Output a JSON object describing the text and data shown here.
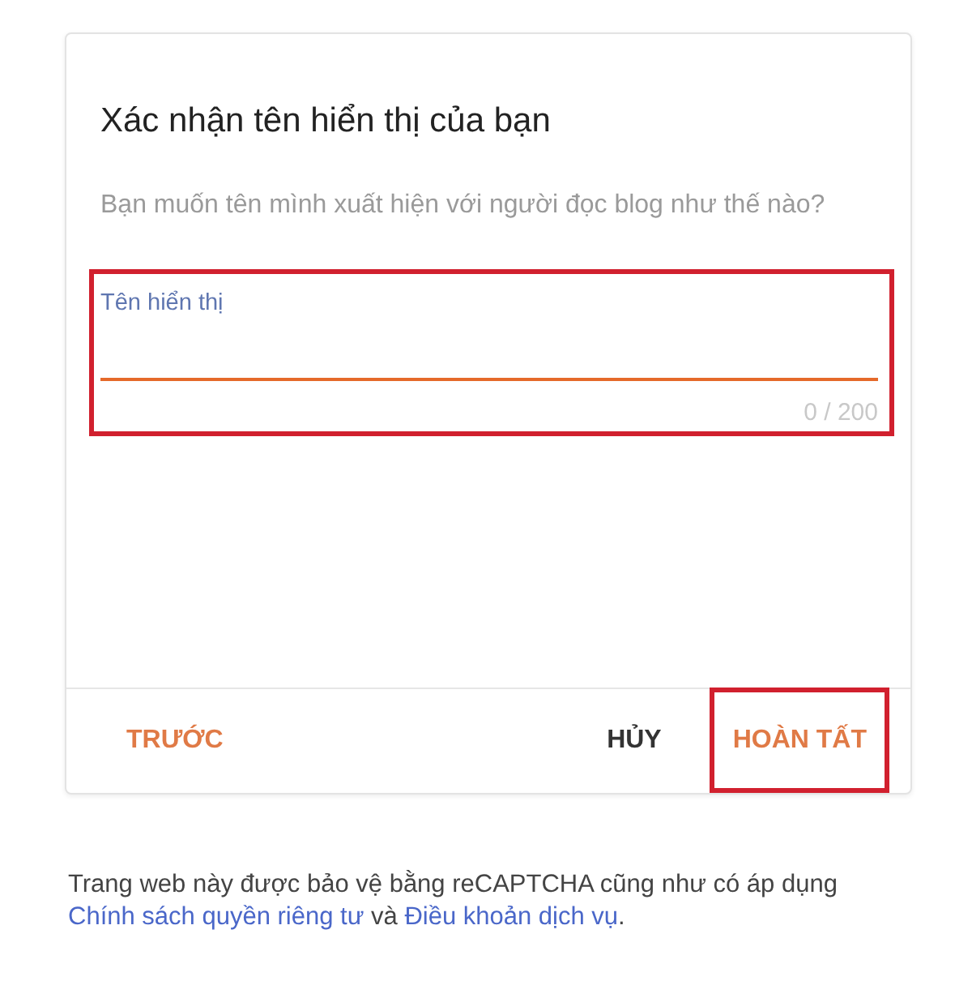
{
  "dialog": {
    "title": "Xác nhận tên hiển thị của bạn",
    "description": "Bạn muốn tên mình xuất hiện với người đọc blog như thế nào?",
    "name_field": {
      "label": "Tên hiển thị",
      "counter": "0 / 200",
      "focused": true,
      "highlighted": true
    },
    "buttons": [
      {
        "label": "TRƯỚC",
        "kind": "accent",
        "highlighted": false
      },
      {
        "label": "HỦY",
        "kind": "neutral",
        "highlighted": false
      },
      {
        "label": "HOÀN TẤT",
        "kind": "accent",
        "highlighted": true
      }
    ]
  },
  "notice": {
    "parts": [
      {
        "kind": "text",
        "text": "Trang web này được bảo vệ bằng reCAPTCHA cũng như có áp dụng "
      },
      {
        "kind": "link",
        "text": "Chính sách quyền riêng tư"
      },
      {
        "kind": "text",
        "text": " và "
      },
      {
        "kind": "link",
        "text": "Điều khoản dịch vụ"
      },
      {
        "kind": "text",
        "text": "."
      }
    ]
  }
}
